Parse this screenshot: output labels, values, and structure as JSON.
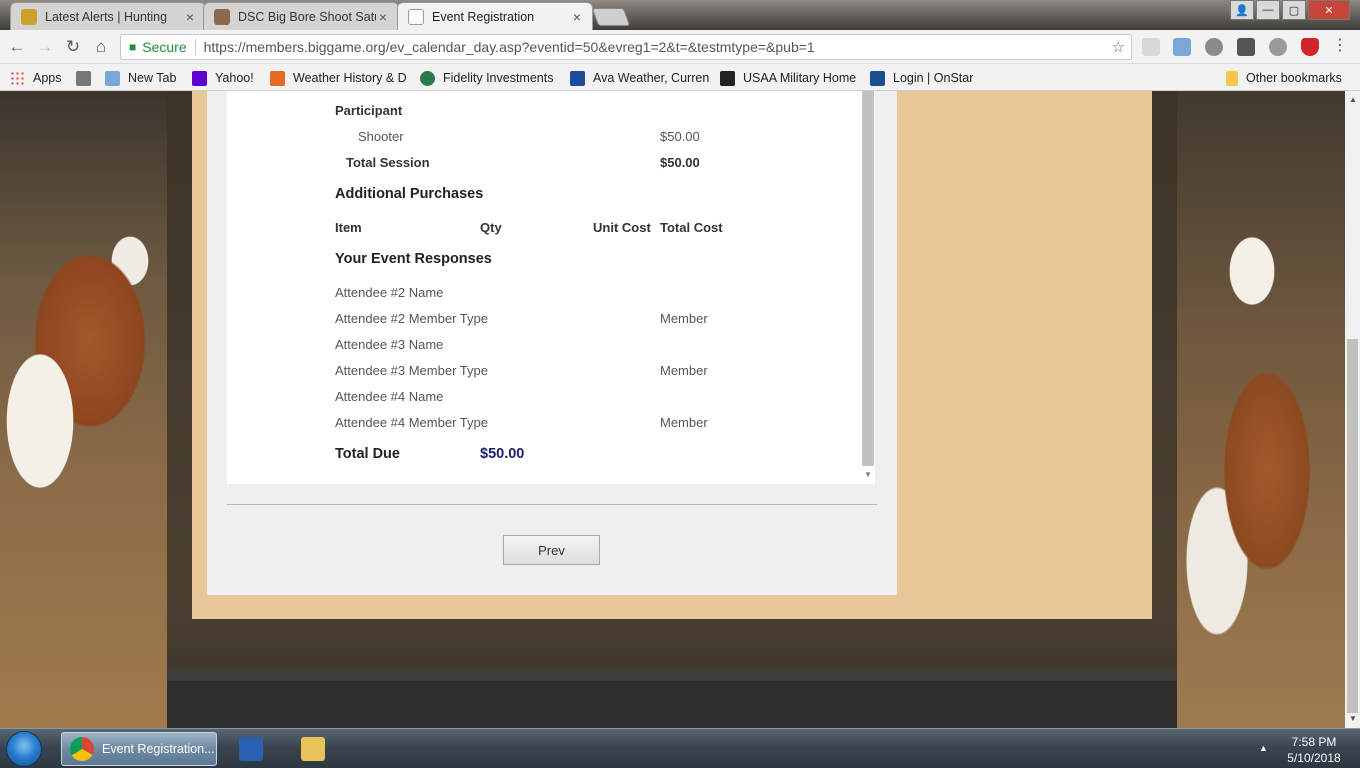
{
  "tabs": [
    {
      "title": "Latest Alerts | Hunting",
      "favicon_color": "#c9a227"
    },
    {
      "title": "DSC Big Bore Shoot Satu",
      "favicon_color": "#8a6a4a"
    },
    {
      "title": "Event Registration",
      "favicon_color": "#ffffff"
    }
  ],
  "tab_close_glyph": "×",
  "window_controls": {
    "user": "👤",
    "minimize": "—",
    "maximize": "▢",
    "close": "✕"
  },
  "toolbar": {
    "back": "←",
    "forward": "→",
    "reload": "↻",
    "home": "⌂",
    "secure_label": "Secure",
    "url": "https://members.biggame.org/ev_calendar_day.asp?eventid=50&evreg1=2&t=&testmtype=&pub=1",
    "star": "☆"
  },
  "bookmarks": [
    {
      "label": "Apps",
      "icon_color": "#d44"
    },
    {
      "label": "",
      "icon_color": "#777"
    },
    {
      "label": "New Tab",
      "icon_color": "#7aa7d8"
    },
    {
      "label": "Yahoo!",
      "icon_color": "#5f01d1"
    },
    {
      "label": "Weather History & D",
      "icon_color": "#e66a1f"
    },
    {
      "label": "Fidelity Investments",
      "icon_color": "#2a7a4b"
    },
    {
      "label": "Ava Weather, Curren",
      "icon_color": "#1f4a99"
    },
    {
      "label": "USAA Military Home",
      "icon_color": "#222"
    },
    {
      "label": "Login | OnStar",
      "icon_color": "#1a4e8f"
    }
  ],
  "other_bookmarks": "Other bookmarks",
  "summary": {
    "participant_heading": "Participant",
    "shooter_label": "Shooter",
    "shooter_amount": "$50.00",
    "total_session_label": "Total Session",
    "total_session_amount": "$50.00",
    "additional_purchases_heading": "Additional Purchases",
    "columns": {
      "item": "Item",
      "qty": "Qty",
      "unit_cost": "Unit Cost",
      "total_cost": "Total Cost"
    },
    "responses_heading": "Your Event Responses",
    "responses": [
      {
        "label": "Attendee #2 Name",
        "value": ""
      },
      {
        "label": "Attendee #2 Member Type",
        "value": "Member"
      },
      {
        "label": "Attendee #3 Name",
        "value": ""
      },
      {
        "label": "Attendee #3 Member Type",
        "value": "Member"
      },
      {
        "label": "Attendee #4 Name",
        "value": ""
      },
      {
        "label": "Attendee #4 Member Type",
        "value": "Member"
      }
    ],
    "total_due_label": "Total Due",
    "total_due_amount": "$50.00"
  },
  "prev_button": "Prev",
  "taskbar": {
    "active_task": "Event Registration...",
    "time": "7:58 PM",
    "date": "5/10/2018",
    "tray_arrow": "▲"
  }
}
